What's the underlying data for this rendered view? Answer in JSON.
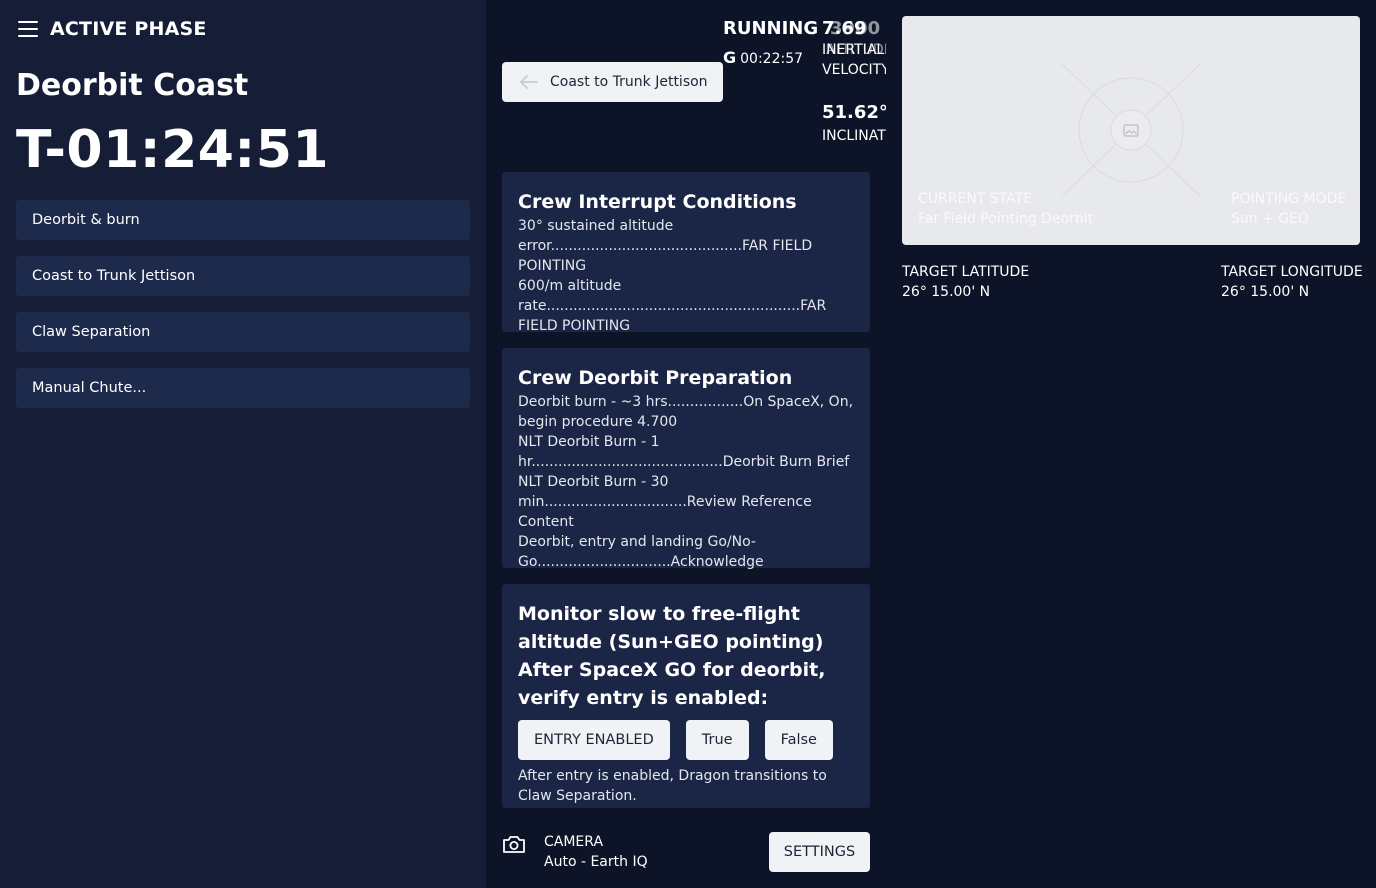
{
  "sidebar": {
    "phase_label": "ACTIVE PHASE",
    "phase_name": "Deorbit Coast",
    "countdown": "T-01:24:51",
    "items": [
      {
        "label": "Deorbit & burn"
      },
      {
        "label": "Coast to Trunk Jettison"
      },
      {
        "label": "Claw Separation"
      },
      {
        "label": "Manual Chute..."
      }
    ]
  },
  "header": {
    "back_label": "Coast to Trunk Jettison",
    "status": "RUNNING",
    "g_label": "G",
    "elapsed": "00:22:57",
    "velocity_value": "7.69",
    "velocity_value_overlay": "3900",
    "velocity_label": "INERTIAL",
    "velocity_label_overlay": "ALTITUDE",
    "velocity_label2": "VELOCITY",
    "inclination_value": "51.62°",
    "inclination_label": "INCLINATION"
  },
  "cards": {
    "interrupt": {
      "title": "Crew Interrupt Conditions",
      "lines": [
        "30° sustained altitude error...........................................FAR FIELD POINTING",
        "600/m altitude rate.........................................................FAR FIELD POINTING"
      ]
    },
    "deorbit_prep": {
      "title": "Crew Deorbit Preparation",
      "lines": [
        "Deorbit burn - ~3 hrs.................On SpaceX, On, begin procedure 4.700",
        "NLT Deorbit Burn - 1 hr...........................................Deorbit Burn Brief",
        "NLT Deorbit Burn - 30 min................................Review Reference Content",
        "Deorbit, entry and landing Go/No-Go..............................Acknowledge"
      ]
    },
    "monitor": {
      "line1": "Monitor slow to free-flight altitude (Sun+GEO pointing)",
      "line2": "After SpaceX GO for deorbit, verify entry is enabled:",
      "buttons": [
        "ENTRY ENABLED",
        "True",
        "False"
      ],
      "note": "After entry is enabled, Dragon transitions to Claw Separation."
    }
  },
  "camera": {
    "label": "CAMERA",
    "mode": "Auto - Earth IQ",
    "settings_label": "SETTINGS"
  },
  "viewport": {
    "current_state_label": "CURRENT STATE",
    "current_state_value": "Far Field Pointing Deorbit",
    "pointing_mode_label": "POINTING MODE",
    "pointing_mode_value": "Sun + GEO"
  },
  "target": {
    "lat_label": "TARGET LATITUDE",
    "lat_value": "26° 15.00' N",
    "lon_label": "TARGET LONGITUDE",
    "lon_value": "26° 15.00' N"
  }
}
